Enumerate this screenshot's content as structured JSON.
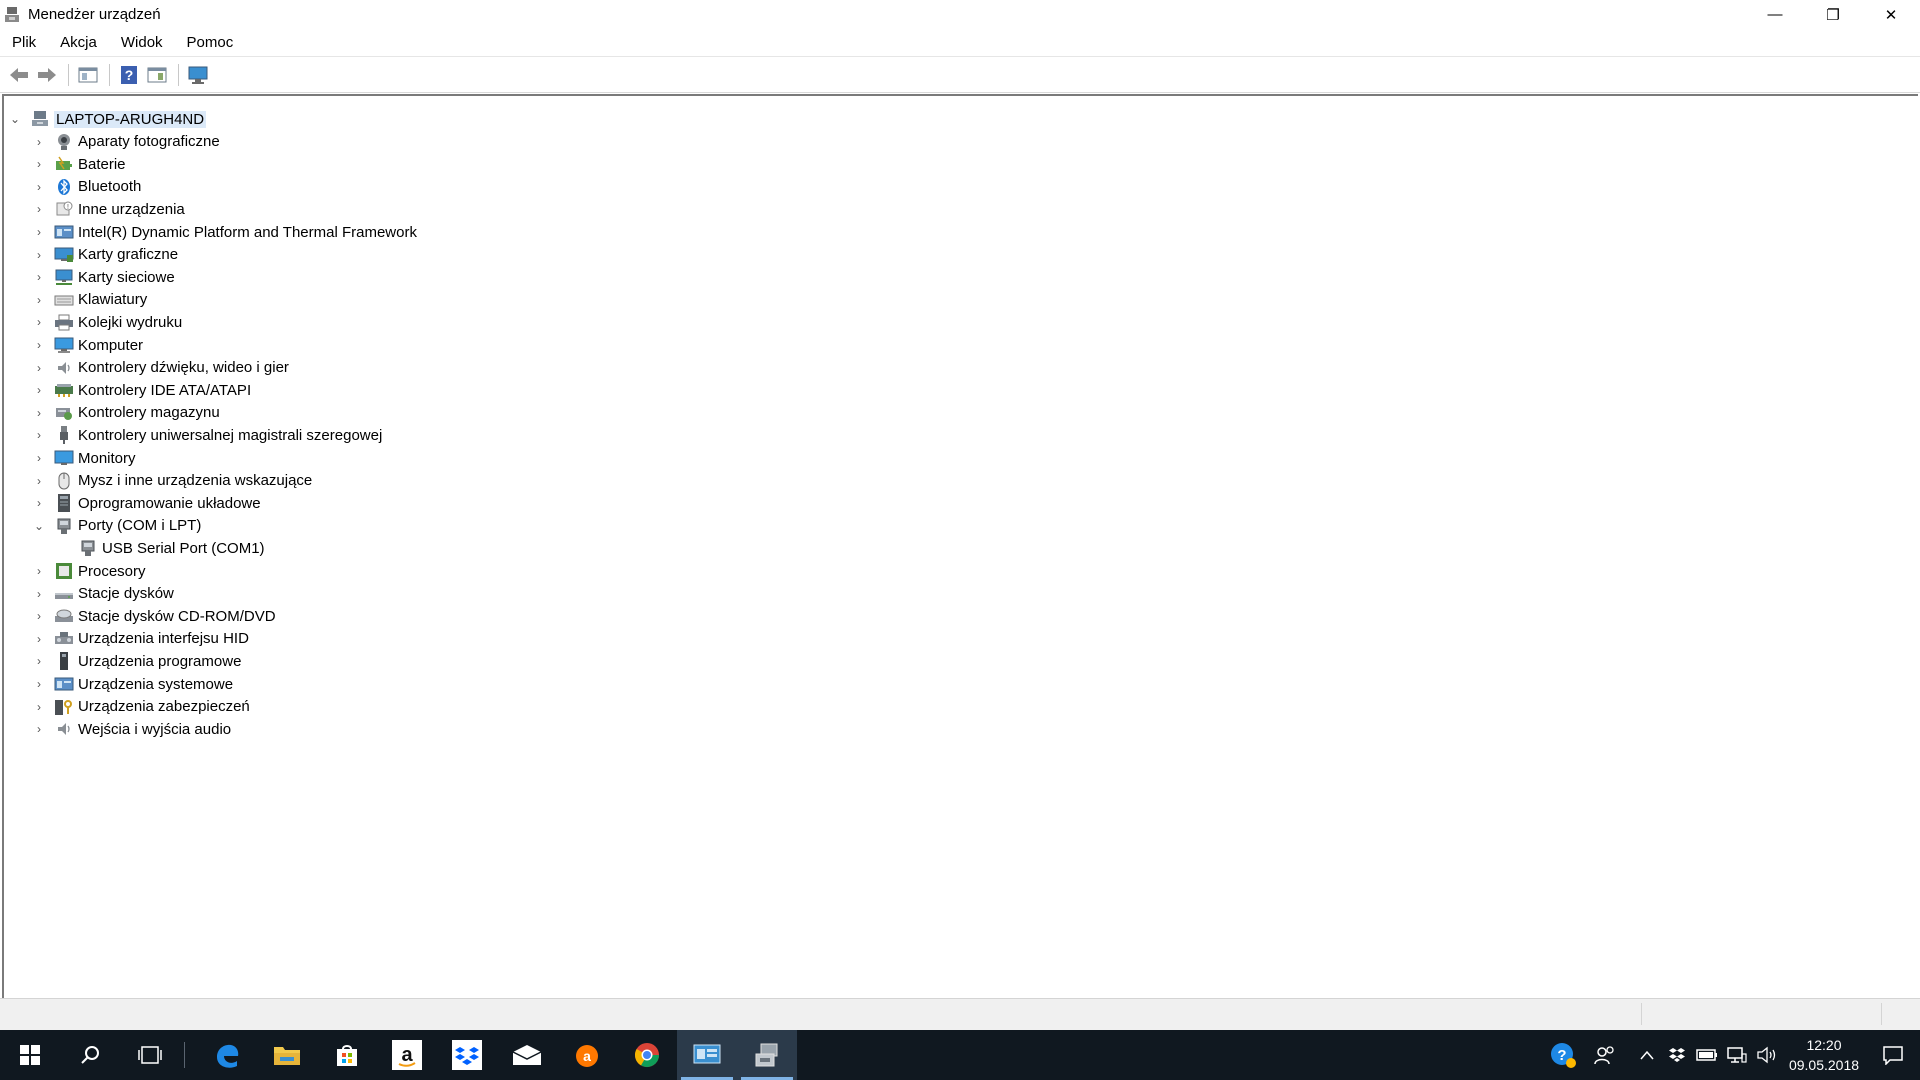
{
  "window": {
    "title": "Menedżer urządzeń",
    "minimize": "—",
    "maximize": "❐",
    "close": "✕"
  },
  "menu": [
    "Plik",
    "Akcja",
    "Widok",
    "Pomoc"
  ],
  "toolbar": {
    "icons": [
      "back-arrow-icon",
      "forward-arrow-icon",
      "properties-icon",
      "help-icon",
      "view-icon",
      "monitor-scan-icon"
    ]
  },
  "tree": {
    "root": {
      "label": "LAPTOP-ARUGH4ND",
      "expander": "⌄",
      "icon": "computer-network-icon"
    },
    "items": [
      {
        "label": "Aparaty fotograficzne",
        "icon": "camera-icon",
        "expander": "›"
      },
      {
        "label": "Baterie",
        "icon": "battery-icon",
        "expander": "›"
      },
      {
        "label": "Bluetooth",
        "icon": "bluetooth-icon",
        "expander": "›"
      },
      {
        "label": "Inne urządzenia",
        "icon": "unknown-device-icon",
        "expander": "›"
      },
      {
        "label": "Intel(R) Dynamic Platform and Thermal Framework",
        "icon": "system-device-icon",
        "expander": "›"
      },
      {
        "label": "Karty graficzne",
        "icon": "display-adapter-icon",
        "expander": "›"
      },
      {
        "label": "Karty sieciowe",
        "icon": "network-adapter-icon",
        "expander": "›"
      },
      {
        "label": "Klawiatury",
        "icon": "keyboard-icon",
        "expander": "›"
      },
      {
        "label": "Kolejki wydruku",
        "icon": "printer-icon",
        "expander": "›"
      },
      {
        "label": "Komputer",
        "icon": "computer-icon",
        "expander": "›"
      },
      {
        "label": "Kontrolery dźwięku, wideo i gier",
        "icon": "speaker-icon",
        "expander": "›"
      },
      {
        "label": "Kontrolery IDE ATA/ATAPI",
        "icon": "ide-controller-icon",
        "expander": "›"
      },
      {
        "label": "Kontrolery magazynu",
        "icon": "storage-controller-icon",
        "expander": "›"
      },
      {
        "label": "Kontrolery uniwersalnej magistrali szeregowej",
        "icon": "usb-icon",
        "expander": "›"
      },
      {
        "label": "Monitory",
        "icon": "monitor-icon",
        "expander": "›"
      },
      {
        "label": "Mysz i inne urządzenia wskazujące",
        "icon": "mouse-icon",
        "expander": "›"
      },
      {
        "label": "Oprogramowanie układowe",
        "icon": "firmware-icon",
        "expander": "›"
      },
      {
        "label": "Porty (COM i LPT)",
        "icon": "port-icon",
        "expander": "⌄",
        "expanded": true
      },
      {
        "label": "USB Serial Port (COM1)",
        "icon": "port-icon",
        "expander": "",
        "child": true
      },
      {
        "label": "Procesory",
        "icon": "processor-icon",
        "expander": "›"
      },
      {
        "label": "Stacje dysków",
        "icon": "disk-drive-icon",
        "expander": "›"
      },
      {
        "label": "Stacje dysków CD-ROM/DVD",
        "icon": "cdrom-icon",
        "expander": "›"
      },
      {
        "label": "Urządzenia interfejsu HID",
        "icon": "hid-icon",
        "expander": "›"
      },
      {
        "label": "Urządzenia programowe",
        "icon": "software-device-icon",
        "expander": "›"
      },
      {
        "label": "Urządzenia systemowe",
        "icon": "system-device-icon",
        "expander": "›"
      },
      {
        "label": "Urządzenia zabezpieczeń",
        "icon": "security-device-icon",
        "expander": "›"
      },
      {
        "label": "Wejścia i wyjścia audio",
        "icon": "audio-io-icon",
        "expander": "›"
      }
    ]
  },
  "taskbar": {
    "apps": [
      "start-icon",
      "search-icon",
      "task-view-icon",
      "edge-icon",
      "file-explorer-icon",
      "store-icon",
      "amazon-icon",
      "dropbox-icon",
      "mail-icon",
      "avast-icon",
      "chrome-icon",
      "control-panel-icon",
      "device-manager-icon"
    ],
    "clock_time": "12:20",
    "clock_date": "09.05.2018"
  },
  "colors": {
    "selection": "#dbe9f8",
    "taskbar": "#101820",
    "accent": "#7fb3e6"
  }
}
